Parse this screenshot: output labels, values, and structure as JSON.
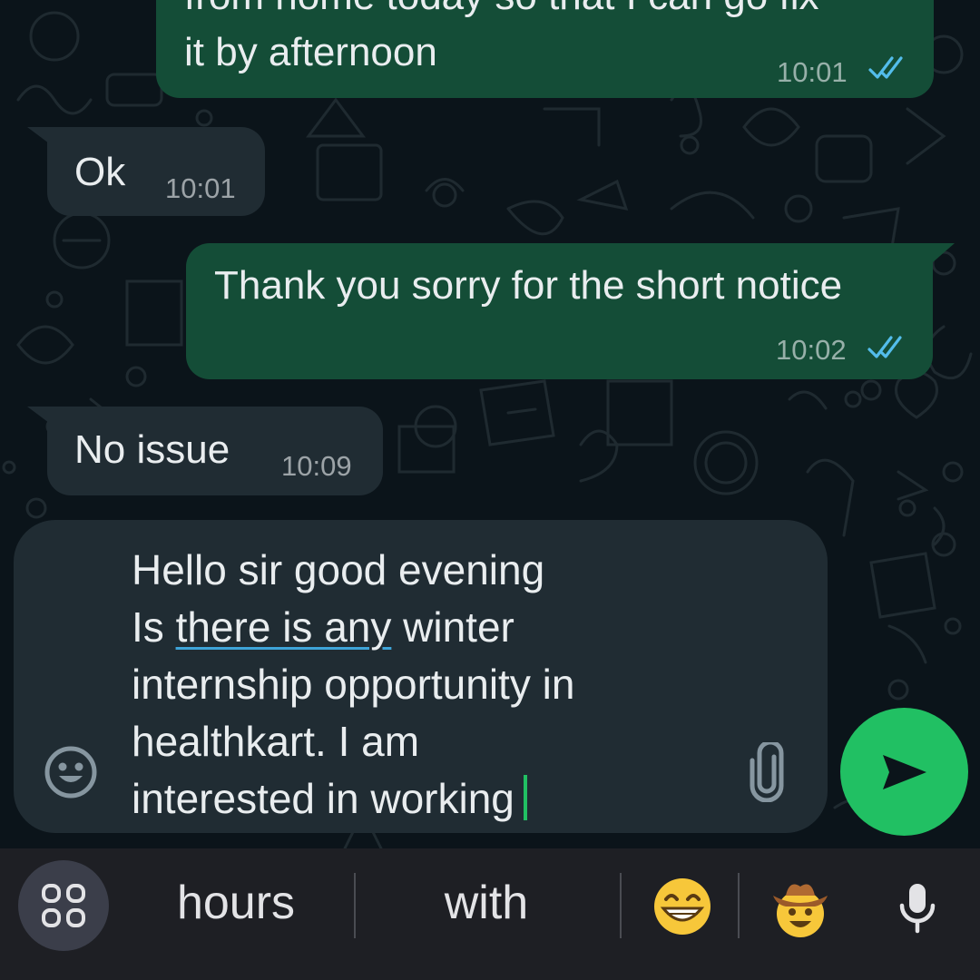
{
  "messages": [
    {
      "direction": "outgoing",
      "text_line1": "from home today so that I can go fix",
      "text_line2": "it by afternoon",
      "time": "10:01",
      "status": "read"
    },
    {
      "direction": "incoming",
      "text": "Ok",
      "time": "10:01"
    },
    {
      "direction": "outgoing",
      "text": "Thank you sorry for the short notice",
      "time": "10:02",
      "status": "read"
    },
    {
      "direction": "incoming",
      "text": "No issue",
      "time": "10:09"
    }
  ],
  "composer": {
    "line1": "Hello sir good evening",
    "line2_prefix": "Is ",
    "line2_flagged": "there is any",
    "line2_suffix": " winter",
    "line3": "internship opportunity in",
    "line4": "healthkart. I am",
    "line5": "interested in working",
    "emoji_icon": "smiley-face-icon",
    "attach_icon": "paperclip-icon",
    "send_icon": "send-arrow-icon"
  },
  "keyboard_suggestions": {
    "word1": "hours",
    "word2": "with",
    "emoji1": "grinning-face-with-smiling-eyes",
    "emoji2": "cowboy-hat-face",
    "grid_icon": "apps-grid-icon",
    "mic_icon": "microphone-icon"
  },
  "colors": {
    "background": "#0b141a",
    "outgoing_bubble": "#144d37",
    "incoming_bubble": "#202c33",
    "read_ticks": "#53bdeb",
    "accent_green": "#21c063",
    "spellcheck_underline": "#3ea4d8"
  }
}
